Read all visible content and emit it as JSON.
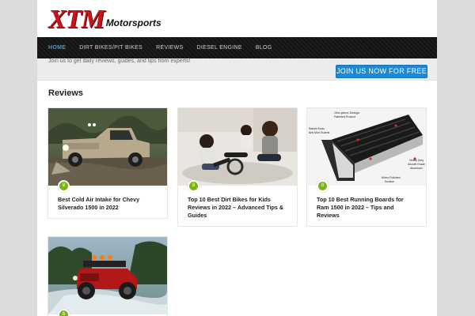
{
  "site": {
    "logo_main": "XTM",
    "logo_sub": "Motorsports"
  },
  "nav": {
    "items": [
      {
        "label": "HOME",
        "active": true
      },
      {
        "label": "DIRT BIKES/PIT BIKES",
        "active": false
      },
      {
        "label": "REVIEWS",
        "active": false
      },
      {
        "label": "DIESEL ENGINE",
        "active": false
      },
      {
        "label": "BLOG",
        "active": false
      }
    ]
  },
  "promo": {
    "text": "Join us to get daily reviews, guides, and tips from experts!",
    "button_label": "JOIN US NOW FOR FREE"
  },
  "section": {
    "title": "Reviews"
  },
  "posts": [
    {
      "title": "Best Cold Air Intake for Chevy Silverado 1500 in 2022",
      "badge": "8",
      "image": "pickup-truck-offroad"
    },
    {
      "title": "Top 10 Best Dirt Bikes for Kids Reviews in 2022 – Advanced Tips & Guides",
      "badge": "8",
      "image": "kids-with-bike"
    },
    {
      "title": "Top 10 Best Running Boards for Ram 1500 in 2022 – Tips and Reviews",
      "badge": "8",
      "image": "running-board",
      "image_labels": [
        "One-piece Design",
        "Patented Product",
        "Raised Ends",
        "Anti Mud Guards",
        "Heavy Duty",
        "Aircraft Grade",
        "Aluminum",
        "Mirror Polished",
        "Surface"
      ]
    },
    {
      "title": "",
      "badge": "8",
      "image": "red-jeep-offroad"
    }
  ],
  "colors": {
    "nav_active": "#3b9be0",
    "button": "#1a8ad8",
    "badge": "#7ab317",
    "logo": "#c8141a"
  }
}
